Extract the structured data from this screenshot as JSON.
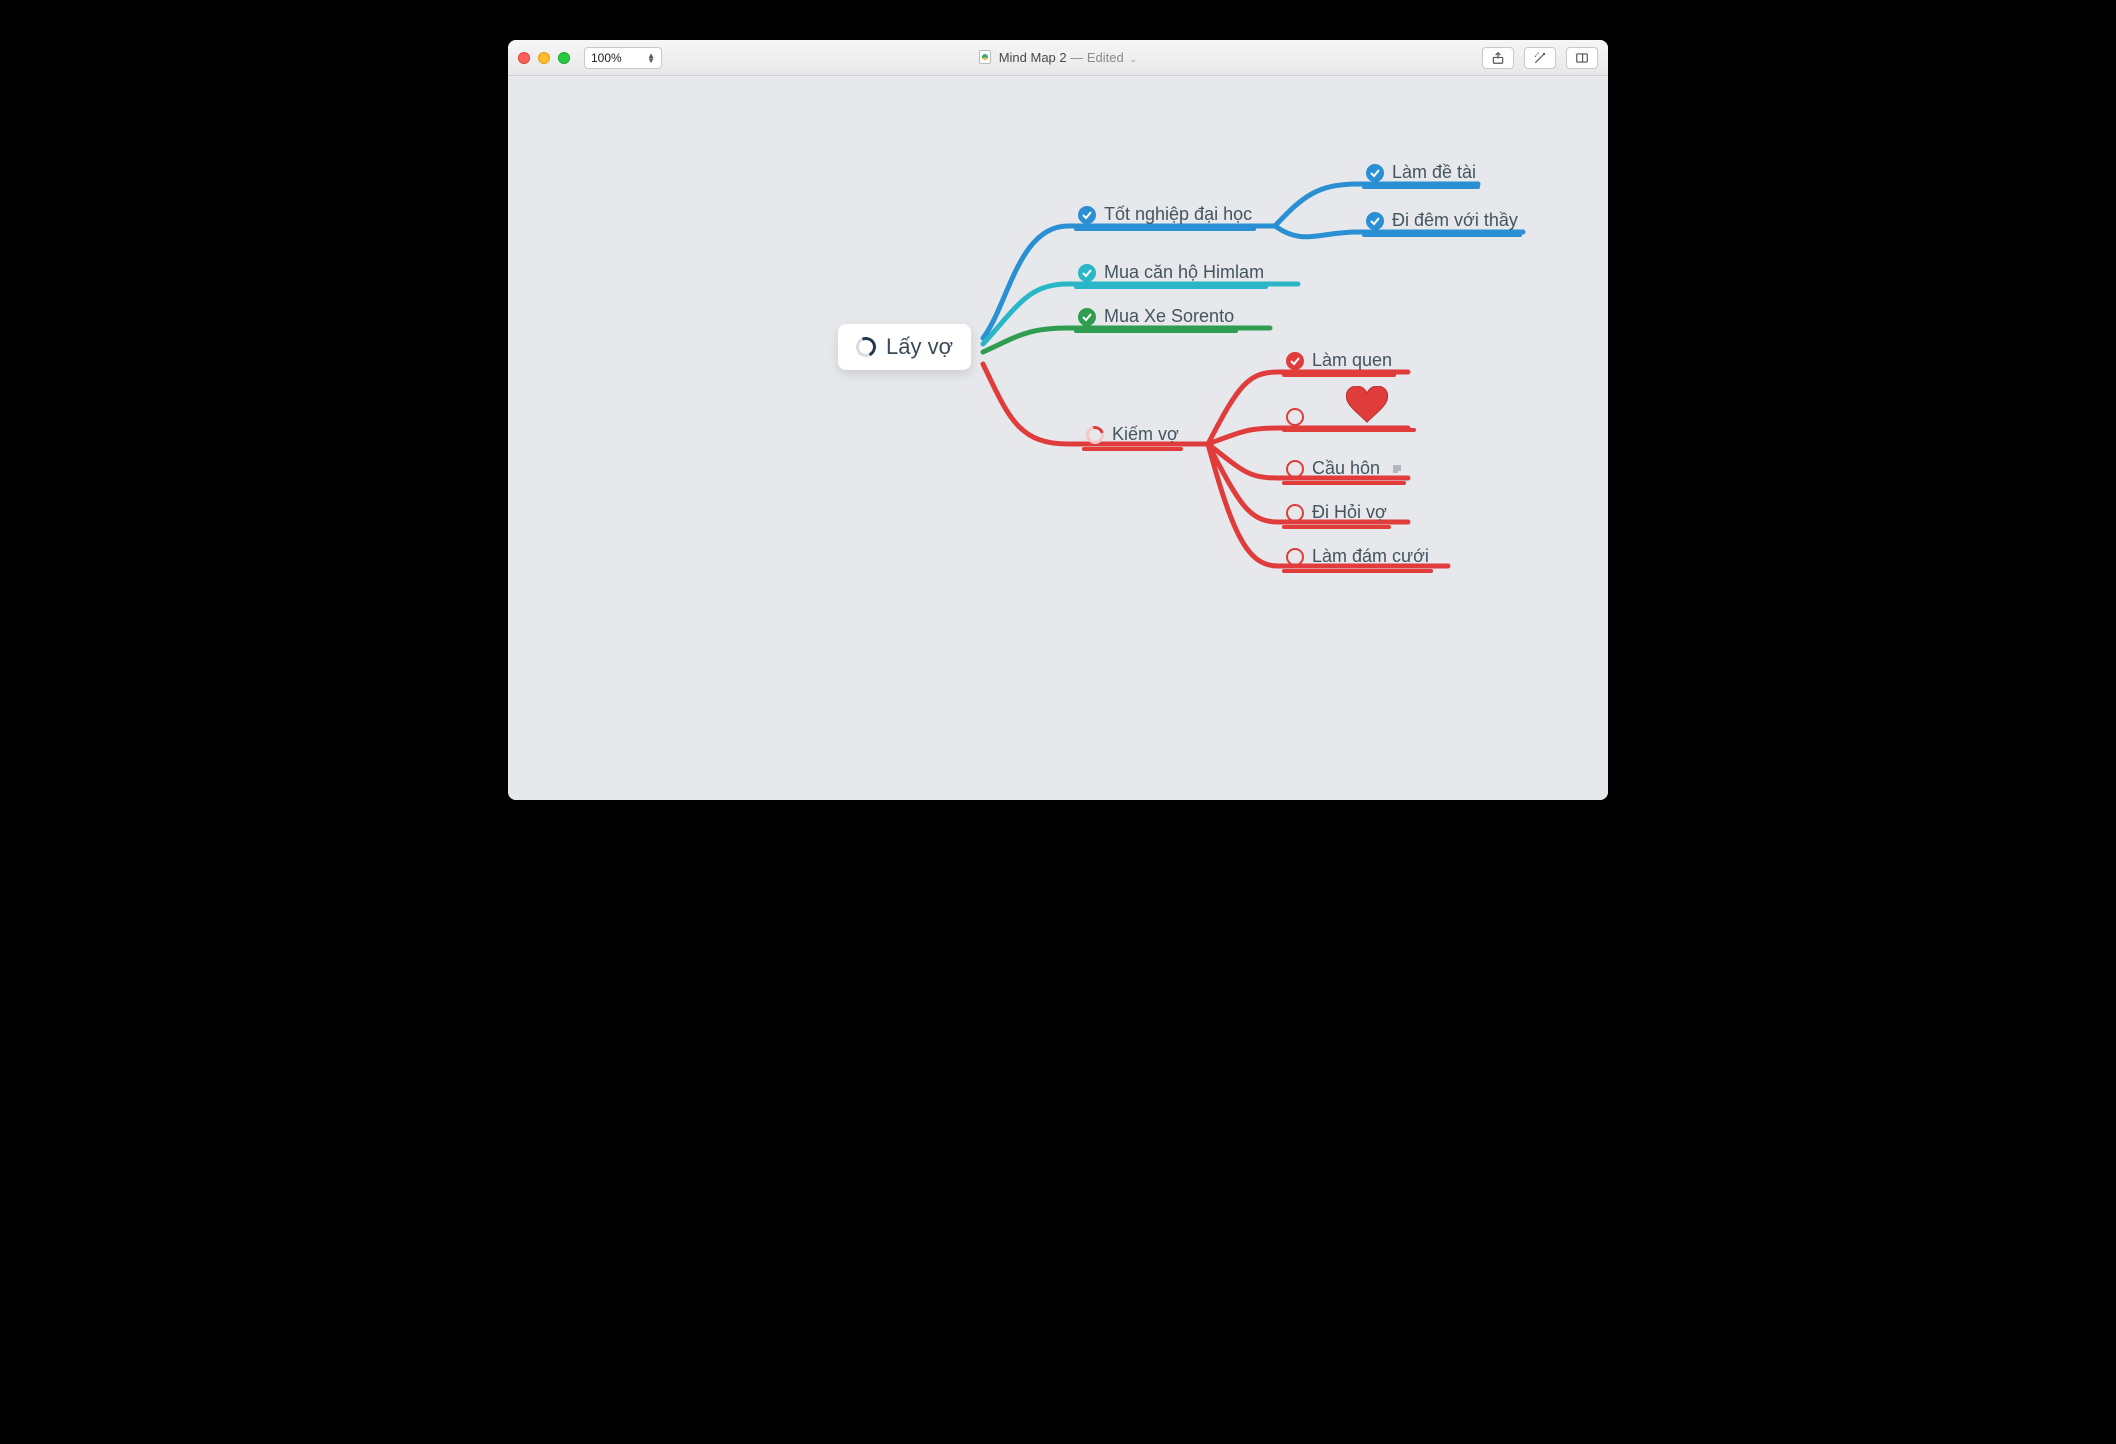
{
  "window": {
    "zoom": "100%",
    "doc_title": "Mind Map 2",
    "edited_suffix": " — Edited"
  },
  "colors": {
    "blue": "#2a8fd3",
    "teal": "#29b6c6",
    "green": "#2e9d4f",
    "red": "#e03c3c"
  },
  "root": {
    "label": "Lấy vợ",
    "status": "partial"
  },
  "nodes": {
    "grad": {
      "label": "Tốt nghiệp đại học",
      "color": "blue",
      "status": "done"
    },
    "topic": {
      "label": "Làm đề tài",
      "color": "blue",
      "status": "done"
    },
    "night": {
      "label": "Đi đêm với thầy",
      "color": "blue",
      "status": "done"
    },
    "apt": {
      "label": "Mua căn hộ Himlam",
      "color": "teal",
      "status": "done"
    },
    "car": {
      "label": "Mua Xe Sorento",
      "color": "green",
      "status": "done"
    },
    "findwife": {
      "label": "Kiếm vợ",
      "color": "red",
      "status": "partial"
    },
    "meet": {
      "label": "Làm quen",
      "color": "red",
      "status": "done"
    },
    "heart": {
      "label": "",
      "color": "red",
      "status": "open",
      "icon": "heart"
    },
    "propose": {
      "label": "Cầu hôn",
      "color": "red",
      "status": "open",
      "has_note": true
    },
    "ask": {
      "label": "Đi Hỏi vợ",
      "color": "red",
      "status": "open"
    },
    "wedding": {
      "label": "Làm đám cưới",
      "color": "red",
      "status": "open"
    }
  }
}
